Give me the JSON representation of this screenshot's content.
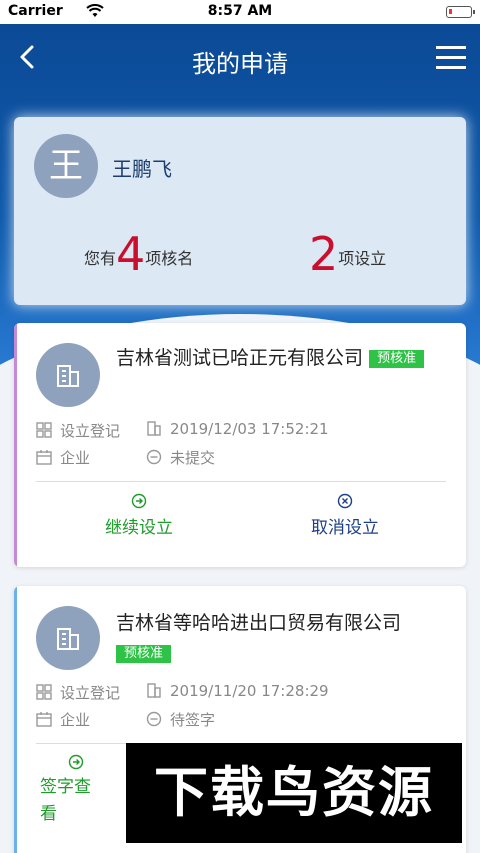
{
  "status_bar": {
    "carrier": "Carrier",
    "time": "8:57 AM"
  },
  "nav": {
    "title": "我的申请"
  },
  "user": {
    "avatar_char": "王",
    "name": "王鹏飞",
    "stat_core": {
      "prefix": "您有",
      "count": "4",
      "suffix": "项核名"
    },
    "stat_setup": {
      "count": "2",
      "suffix": "项设立"
    }
  },
  "requests": [
    {
      "company": "吉林省测试已哈正元有限公司",
      "tag": "预核准",
      "type": "设立登记",
      "date": "2019/12/03 17:52:21",
      "category": "企业",
      "status": "未提交",
      "actions": [
        "继续设立",
        "取消设立"
      ]
    },
    {
      "company": "吉林省等哈哈进出口贸易有限公司",
      "tag": "预核准",
      "type": "设立登记",
      "date": "2019/11/20 17:28:29",
      "category": "企业",
      "status": "待签字",
      "actions": [
        "签字查看"
      ]
    }
  ],
  "watermark": "下载鸟资源",
  "colors": {
    "nav_blue": "#0c4a96",
    "accent_red": "#c8102e",
    "tag_green": "#2ec246",
    "action_green": "#1e9c2a",
    "action_blue": "#1c3e8a"
  }
}
